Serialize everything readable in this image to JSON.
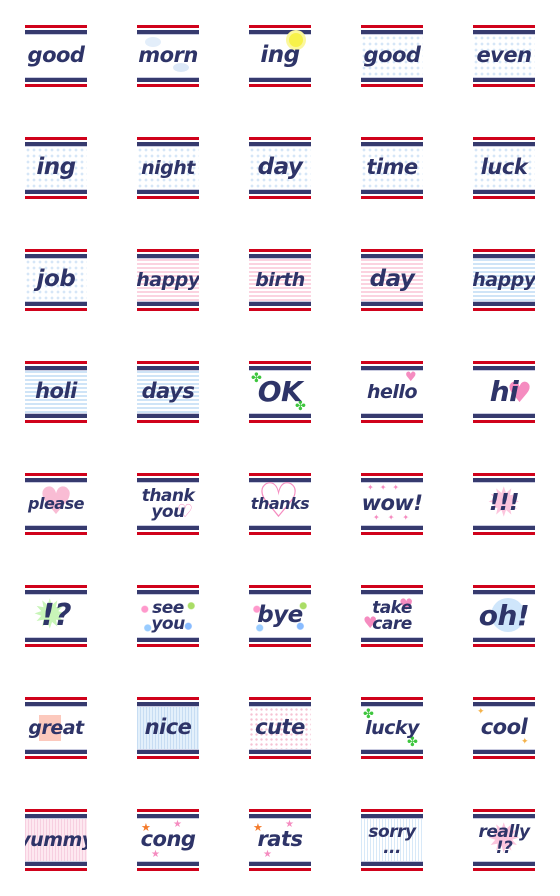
{
  "colors": {
    "navy": "#2e3468",
    "red": "#d0021b"
  },
  "stickers": [
    {
      "lines": [
        "good"
      ],
      "bg": "plain",
      "deco": ""
    },
    {
      "lines": [
        "morn"
      ],
      "bg": "plain",
      "deco": "clouds"
    },
    {
      "lines": [
        "ing"
      ],
      "bg": "plain",
      "deco": "sun"
    },
    {
      "lines": [
        "good"
      ],
      "bg": "dots",
      "deco": ""
    },
    {
      "lines": [
        "even"
      ],
      "bg": "dots",
      "deco": ""
    },
    {
      "lines": [
        "ing"
      ],
      "bg": "dots",
      "deco": ""
    },
    {
      "lines": [
        "night"
      ],
      "bg": "dots",
      "deco": ""
    },
    {
      "lines": [
        "day"
      ],
      "bg": "dots",
      "deco": ""
    },
    {
      "lines": [
        "time"
      ],
      "bg": "dots",
      "deco": ""
    },
    {
      "lines": [
        "luck"
      ],
      "bg": "dots",
      "deco": ""
    },
    {
      "lines": [
        "job"
      ],
      "bg": "dots",
      "deco": ""
    },
    {
      "lines": [
        "happy"
      ],
      "bg": "pink",
      "deco": ""
    },
    {
      "lines": [
        "birth"
      ],
      "bg": "pink",
      "deco": ""
    },
    {
      "lines": [
        "day"
      ],
      "bg": "pink",
      "deco": ""
    },
    {
      "lines": [
        "happy"
      ],
      "bg": "blue",
      "deco": ""
    },
    {
      "lines": [
        "holi"
      ],
      "bg": "blue",
      "deco": ""
    },
    {
      "lines": [
        "days"
      ],
      "bg": "blue",
      "deco": ""
    },
    {
      "lines": [
        "OK"
      ],
      "bg": "plain",
      "deco": "clover"
    },
    {
      "lines": [
        "hello"
      ],
      "bg": "plain",
      "deco": "heart-small"
    },
    {
      "lines": [
        "hi"
      ],
      "bg": "plain",
      "deco": "heart-right"
    },
    {
      "lines": [
        "please"
      ],
      "bg": "plain",
      "deco": "heart-pink"
    },
    {
      "lines": [
        "thank",
        "you"
      ],
      "bg": "plain",
      "deco": "heart-outline"
    },
    {
      "lines": [
        "thanks"
      ],
      "bg": "plain",
      "deco": "heart-outline-big"
    },
    {
      "lines": [
        "wow!"
      ],
      "bg": "plain",
      "deco": "stars"
    },
    {
      "lines": [
        "!!!"
      ],
      "bg": "plain",
      "deco": "burst-pink"
    },
    {
      "lines": [
        "!?"
      ],
      "bg": "plain",
      "deco": "burst-green"
    },
    {
      "lines": [
        "see",
        "you"
      ],
      "bg": "plain",
      "deco": "confetti"
    },
    {
      "lines": [
        "bye"
      ],
      "bg": "plain",
      "deco": "confetti"
    },
    {
      "lines": [
        "take",
        "care"
      ],
      "bg": "plain",
      "deco": "hearts"
    },
    {
      "lines": [
        "oh!"
      ],
      "bg": "plain",
      "deco": "circle-blue"
    },
    {
      "lines": [
        "great"
      ],
      "bg": "plain",
      "deco": "square-peach"
    },
    {
      "lines": [
        "nice"
      ],
      "bg": "bluegrid",
      "deco": ""
    },
    {
      "lines": [
        "cute"
      ],
      "bg": "pinkdots",
      "deco": ""
    },
    {
      "lines": [
        "lucky"
      ],
      "bg": "plain",
      "deco": "clover"
    },
    {
      "lines": [
        "cool"
      ],
      "bg": "plain",
      "deco": "sparkle"
    },
    {
      "lines": [
        "yummy"
      ],
      "bg": "pinkgrid",
      "deco": ""
    },
    {
      "lines": [
        "cong"
      ],
      "bg": "plain",
      "deco": "stars-color"
    },
    {
      "lines": [
        "rats"
      ],
      "bg": "plain",
      "deco": "stars-color"
    },
    {
      "lines": [
        "sorry",
        "..."
      ],
      "bg": "vblue",
      "deco": ""
    },
    {
      "lines": [
        "really",
        "!?"
      ],
      "bg": "plain",
      "deco": "burst-pink"
    }
  ]
}
